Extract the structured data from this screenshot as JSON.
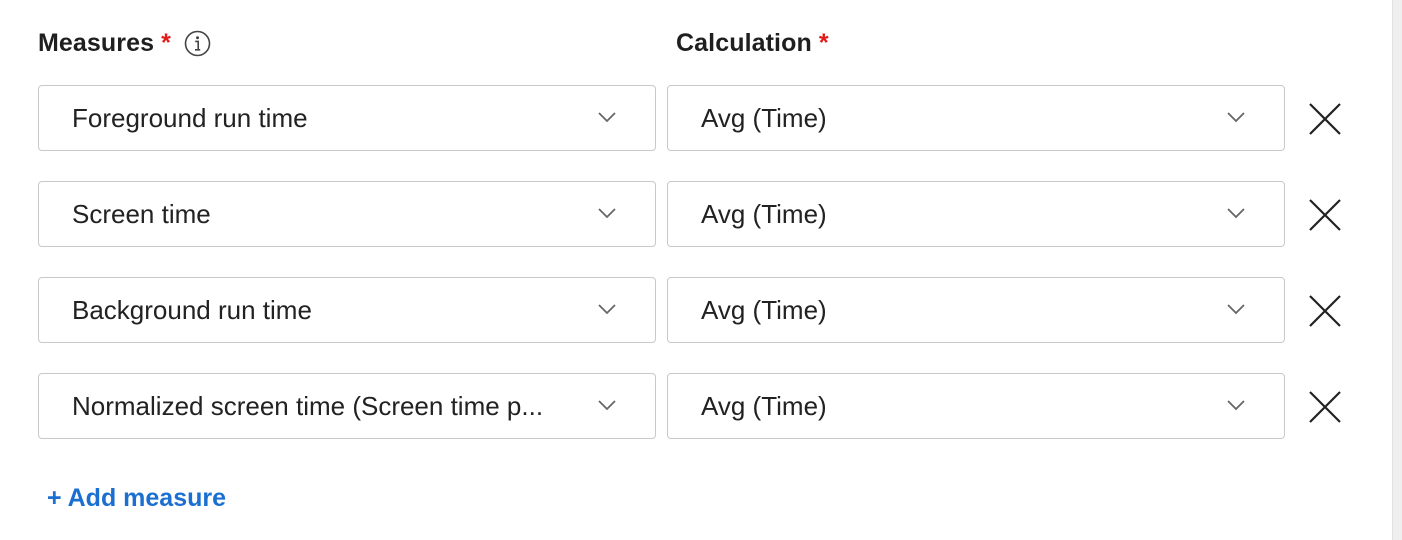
{
  "header": {
    "measures_label": "Measures",
    "calculation_label": "Calculation",
    "required_mark": "*"
  },
  "rows": [
    {
      "measure": "Foreground run time",
      "calculation": "Avg (Time)"
    },
    {
      "measure": "Screen time",
      "calculation": "Avg (Time)"
    },
    {
      "measure": "Background run time",
      "calculation": "Avg (Time)"
    },
    {
      "measure": "Normalized screen time (Screen time p...",
      "calculation": "Avg (Time)"
    }
  ],
  "add_measure_label": "+ Add measure",
  "icons": {
    "info": "info-circle-icon",
    "chevron": "chevron-down-icon",
    "remove": "close-icon"
  },
  "colors": {
    "required": "#e21a1a",
    "link": "#1a6fd1",
    "border": "#c9c9c9"
  }
}
